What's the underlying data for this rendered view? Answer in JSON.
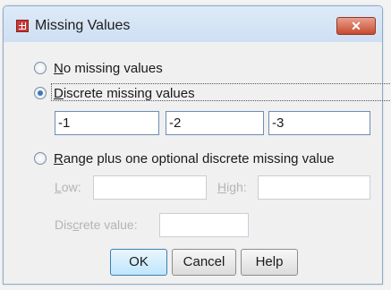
{
  "window": {
    "title": "Missing Values",
    "close_symbol": "✕"
  },
  "options": {
    "no_missing": {
      "underline": "N",
      "rest": "o missing values",
      "selected": false
    },
    "discrete": {
      "underline": "D",
      "rest": "iscrete missing values",
      "selected": true
    },
    "range": {
      "underline": "R",
      "rest": "ange plus one optional discrete missing value",
      "selected": false
    }
  },
  "discrete_values": [
    "-1",
    "-2",
    "-3"
  ],
  "range_fields": {
    "low_u": "L",
    "low_rest": "ow:",
    "high_u": "H",
    "high_rest": "igh:",
    "discrete_pre": "Dis",
    "discrete_u": "c",
    "discrete_rest": "rete value:"
  },
  "buttons": {
    "ok": "OK",
    "cancel": "Cancel",
    "help": "Help"
  }
}
